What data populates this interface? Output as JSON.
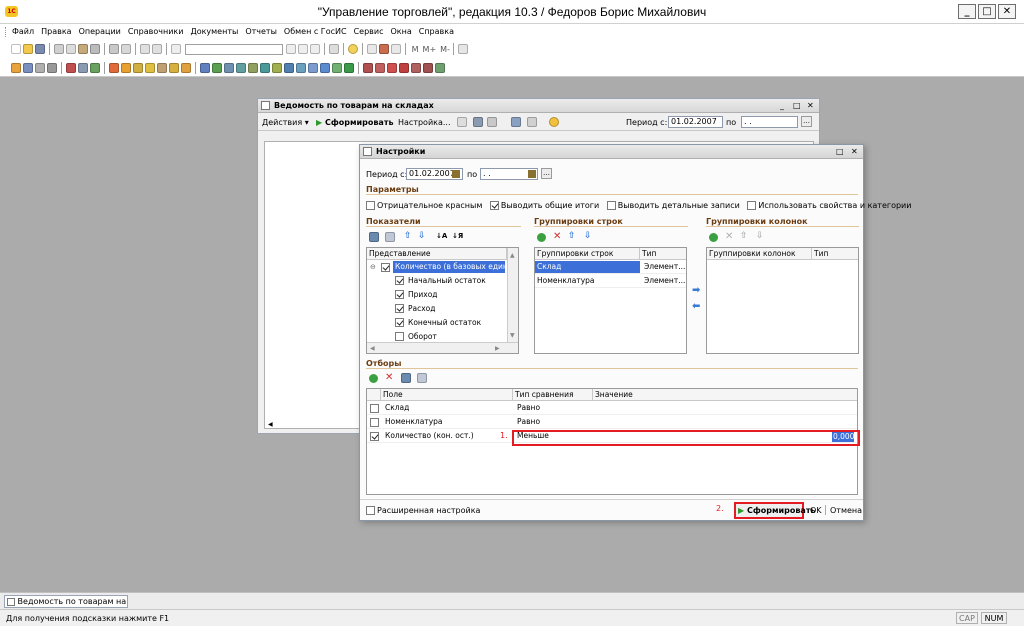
{
  "window": {
    "title": "\"Управление торговлей\", редакция 10.3 / Федоров Борис Михайлович",
    "app_icon": "1c-logo-icon"
  },
  "menu": [
    "Файл",
    "Правка",
    "Операции",
    "Справочники",
    "Документы",
    "Отчеты",
    "Обмен с ГосИС",
    "Сервис",
    "Окна",
    "Справка"
  ],
  "toolbar": {
    "m_labels": [
      "M",
      "M+",
      "M-"
    ]
  },
  "report": {
    "title": "Ведомость по товарам на складах",
    "actions": "Действия",
    "form": "Сформировать",
    "settings": "Настройка...",
    "period_from_label": "Период с:",
    "period_from": "01.02.2007",
    "period_to_label": "по",
    "period_to": " .  ."
  },
  "settings": {
    "title": "Настройки",
    "period_from_label": "Период с:",
    "period_from": "01.02.2007",
    "period_to_label": "по",
    "period_to": " .  .",
    "params_title": "Параметры",
    "params": [
      {
        "label": "Отрицательное красным",
        "checked": false
      },
      {
        "label": "Выводить общие итоги",
        "checked": true
      },
      {
        "label": "Выводить детальные записи",
        "checked": false
      },
      {
        "label": "Использовать свойства и категории",
        "checked": false
      }
    ],
    "indicators": {
      "title": "Показатели",
      "column": "Представление",
      "root": "Количество (в базовых единиц",
      "items": [
        "Начальный остаток",
        "Приход",
        "Расход",
        "Конечный остаток",
        "Оборот"
      ],
      "checked": [
        true,
        true,
        true,
        true,
        false
      ]
    },
    "row_groups": {
      "title": "Группировки строк",
      "col1": "Группировки строк",
      "col2": "Тип",
      "rows": [
        {
          "name": "Склад",
          "type": "Элемент..."
        },
        {
          "name": "Номенклатура",
          "type": "Элемент..."
        }
      ]
    },
    "col_groups": {
      "title": "Группировки колонок",
      "col1": "Группировки колонок",
      "col2": "Тип"
    },
    "filters": {
      "title": "Отборы",
      "col_field": "Поле",
      "col_cmp": "Тип сравнения",
      "col_val": "Значение",
      "rows": [
        {
          "field": "Склад",
          "cmp": "Равно",
          "value": "",
          "checked": false
        },
        {
          "field": "Номенклатура",
          "cmp": "Равно",
          "value": "",
          "checked": false
        },
        {
          "field": "Количество (кон. ост.)",
          "cmp": "Меньше",
          "value": "0,000",
          "checked": true
        }
      ]
    },
    "advanced": "Расширенная настройка",
    "form_button": "Сформировать",
    "ok": "OK",
    "cancel": "Отмена",
    "callout1": "1.",
    "callout2": "2."
  },
  "taskbar": {
    "item": "Ведомость по товарам на с..."
  },
  "status": {
    "hint": "Для получения подсказки нажмите F1",
    "cap": "CAP",
    "num": "NUM"
  },
  "colors": {
    "accent_red": "#e31b23",
    "selection": "#3d6fd8",
    "section_title": "#6b3d12"
  }
}
